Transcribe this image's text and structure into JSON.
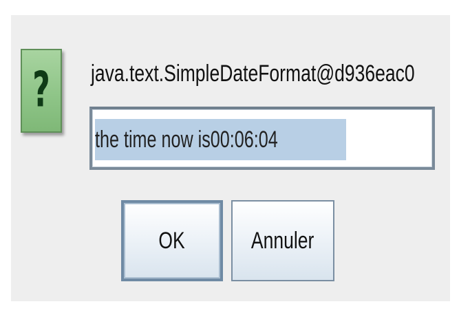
{
  "dialog": {
    "icon": "question-icon",
    "message": "java.text.SimpleDateFormat@d936eac0",
    "input_value": "the time now  is00:06:04",
    "ok_label": "OK",
    "cancel_label": "Annuler"
  }
}
